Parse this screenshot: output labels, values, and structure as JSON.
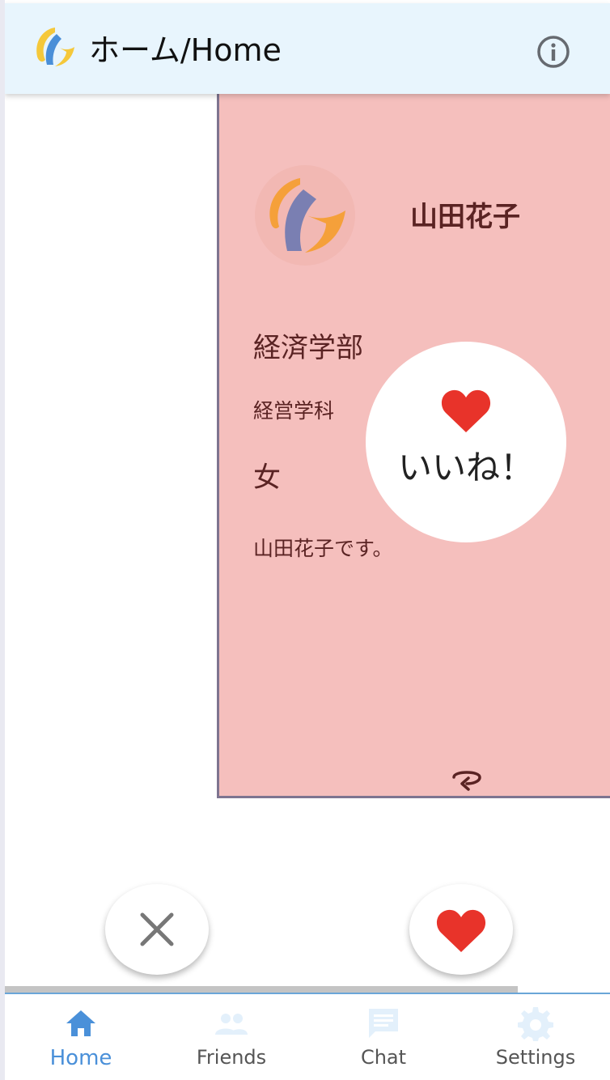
{
  "appbar": {
    "title": "ホーム/Home"
  },
  "card": {
    "name": "山田花子",
    "faculty": "経済学部",
    "department": "経営学科",
    "gender": "女",
    "bio": "山田花子です。"
  },
  "like_overlay": {
    "label": "いいね！"
  },
  "bottom_nav": {
    "items": [
      {
        "label": "Home",
        "icon": "home-icon",
        "active": true
      },
      {
        "label": "Friends",
        "icon": "people-icon",
        "active": false
      },
      {
        "label": "Chat",
        "icon": "chat-icon",
        "active": false
      },
      {
        "label": "Settings",
        "icon": "gear-icon",
        "active": false
      }
    ]
  },
  "colors": {
    "appbar_background": "#e8f5fd",
    "card_background": "#f5bfbd",
    "heart": "#e8332a",
    "nav_active": "#4a90d9",
    "nav_inactive_icon": "#e3f0fb",
    "logo_orange": "#f5a03a",
    "logo_blue": "#4a8fd8",
    "logo_yellow": "#f5c83a",
    "logo_purple": "#7a7fb2"
  }
}
